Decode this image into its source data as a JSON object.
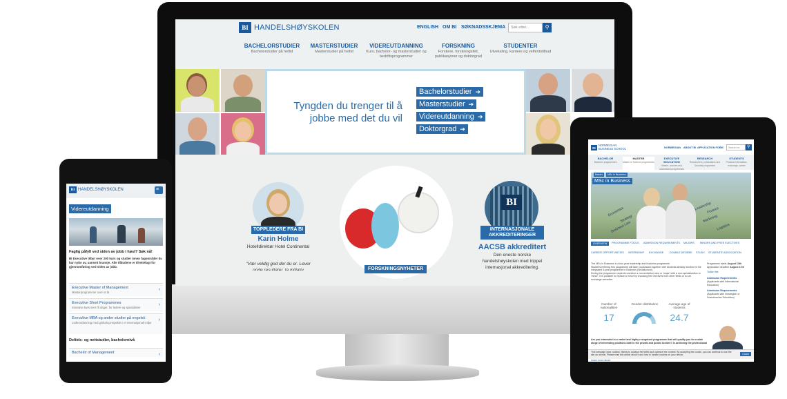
{
  "desktop": {
    "logo_mark": "BI",
    "logo_text": "HANDELSHØYSKOLEN",
    "top_links": [
      "ENGLISH",
      "OM BI",
      "SØKNADSSKJEMA"
    ],
    "search_placeholder": "Søk etter...",
    "nav": [
      {
        "title": "BACHELORSTUDIER",
        "sub": "Bachelorstudier på heltid"
      },
      {
        "title": "MASTERSTUDIER",
        "sub": "Masterstudier på heltid"
      },
      {
        "title": "VIDEREUTDANNING",
        "sub": "Kurs, bachelor- og masterstudier og bedriftsprogrammer"
      },
      {
        "title": "FORSKNING",
        "sub": "Forskere, forskningsfelt, publikasjoner og doktorgrad"
      },
      {
        "title": "STUDENTER",
        "sub": "Utveksling, karriere og velferdstilbud"
      }
    ],
    "hero_text": "Tyngden du trenger til å jobbe med det du vil",
    "hero_buttons": [
      "Bachelorstudier",
      "Masterstudier",
      "Videreutdanning",
      "Doktorgrad"
    ],
    "card1": {
      "badge": "TOPPLEDERE FRA BI",
      "name": "Karin Holme",
      "title": "Hotelldirektør Hotel Continental",
      "quote": "\"Vær veldig god der du er. Lever gode resultater, ta initiativ"
    },
    "card2": {
      "badge": "FORSKNINGSNYHETER"
    },
    "card3": {
      "badge": "INTERNASJONALE AKKREDITERINGER",
      "headline": "AACSB akkreditert",
      "text": "Den eneste norske handelshøyskolen med trippel internasjonal akkreditering.",
      "logo_mark": "BI"
    }
  },
  "phone": {
    "logo_mark": "BI",
    "logo_text": "HANDELSHØYSKOLEN",
    "tag": "Videreutdanning",
    "intro_title": "Faglig påfyll ved siden av jobb i høst? Søk nå!",
    "intro_text": "BI Executive tilbyr over 200 kurs og studier innen fagområder du har nytte av, uansett bransje. Alle tilbudene er tilrettelagt for gjennomføring ved siden av jobb.",
    "items": [
      {
        "title": "Executive Master of Management",
        "sub": "Masterprogrammer over et år"
      },
      {
        "title": "Executive Short Programmes",
        "sub": "Intensive kurs over få dager, for ledere og spesialister"
      },
      {
        "title": "Executive MBA og andre studier på engelsk",
        "sub": "Lederutdanning med globalt perspektiv i et internasjonalt miljø"
      }
    ],
    "section": "Deltids- og nettstudier, bachelornivå",
    "section_item": "Bachelor of Management"
  },
  "tablet": {
    "logo_mark": "BI",
    "logo_text1": "NORWEGIAN",
    "logo_text2": "BUSINESS SCHOOL",
    "top_links": [
      "NORWEGIAN",
      "ABOUT BI",
      "APPLICATION FORM"
    ],
    "search_placeholder": "Search for",
    "nav": [
      {
        "title": "BACHELOR",
        "sub": "Bachelor programmes"
      },
      {
        "title": "MASTER",
        "sub": "Master of Science programmes"
      },
      {
        "title": "EXECUTIVE EDUCATION",
        "sub": "Master, courses and customised programmes"
      },
      {
        "title": "RESEARCH",
        "sub": "Researchers, publications and Doctoral programme"
      },
      {
        "title": "STUDENTS",
        "sub": "Practical information, exchange, career"
      }
    ],
    "breadcrumb": [
      "Master",
      "MSc in Business"
    ],
    "hero_title": "MSc in Business",
    "hero_words": [
      "Economics",
      "Leadership",
      "Finance",
      "Marketing",
      "Strategy",
      "Logistics",
      "Business Law"
    ],
    "tabs": [
      "OVERVIEW",
      "PROGRAMME FOCUS",
      "ADMISSION REQUIREMENTS",
      "MAJORS",
      "MINORS AND FREE ELECTIVES",
      "CAREER OPPORTUNITIES",
      "INTERNSHIP",
      "EXCHANGE",
      "DOUBLE DEGREE",
      "STUDY",
      "STUDENTS' ASSOCIATION"
    ],
    "bullets": [
      "The MSc in Business is a two year leadership and business programme.",
      "Students entering this programme will take coursework together with students already enrolled in the integrated 5-year programme in Business (Siviløkonom).",
      "During the programme students combine a concentration area or 'major' with a non-specialization or 'minor'. It is possible to replace a minor by choosing free electives from other fields or do an exchange semester."
    ],
    "facts": [
      {
        "label": "Programme starts",
        "value": "August 13th"
      },
      {
        "label": "Application deadline",
        "value": "August 17th"
      }
    ],
    "side_links": [
      "Tuition fee",
      "Admission Requirements",
      "(Applicants with International Education)",
      "Admission Requirements",
      "(Applicants with Norwegian or Scandinavian Education)"
    ],
    "stats": [
      {
        "label": "Number of nationalities",
        "value": "17"
      },
      {
        "label": "Gender distribution",
        "value": ""
      },
      {
        "label": "Average age of students",
        "value": "24.7"
      }
    ],
    "cta": "Are you interested in a varied and highly recognized programme that will qualify you for a wide range of interesting positions both in the private and public sectors? In achieving the professional",
    "cookie": "This webpage uses cookies. Mainly to analyse the traffic and optimize the content. By accepting the cookie, you can continue to use the site as normal. Please read this article about it and how to handle cookies on your device.",
    "cookie_btn": "Close",
    "footer_link": "Learn more about"
  },
  "colors": {
    "brand_blue": "#1a5a9c",
    "accent_blue": "#2a6aa8",
    "light_blue": "#5ba3c8"
  }
}
